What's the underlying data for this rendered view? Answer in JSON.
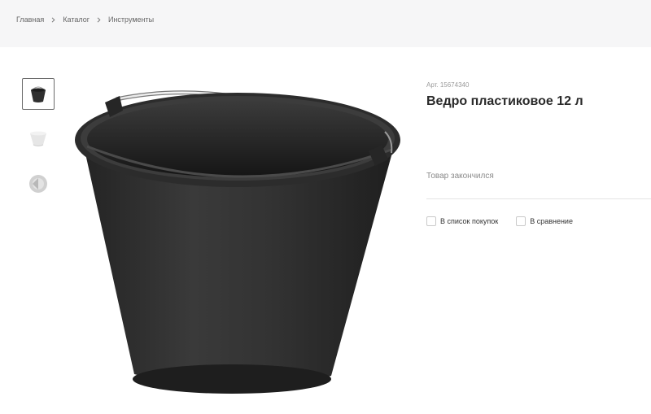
{
  "breadcrumb": {
    "items": [
      "Главная",
      "Каталог",
      "Инструменты"
    ],
    "separator_icon": "chevron-right-icon"
  },
  "gallery": {
    "thumbnails": [
      "bucket-black-icon",
      "bucket-white-icon",
      "round-product-icon"
    ],
    "active_index": 0,
    "main_image": "black-plastic-bucket-image"
  },
  "product": {
    "sku": "Арт. 15674340",
    "title": "Ведро пластиковое 12 л",
    "stock_status": "Товар закончился"
  },
  "actions": {
    "shopping_list_label": "В список покупок",
    "compare_label": "В сравнение",
    "shopping_list_checked": false,
    "compare_checked": false
  },
  "colors": {
    "topbar_bg": "#f6f6f7",
    "bucket": "#2f2f2f",
    "text_primary": "#2a2a2a",
    "text_muted": "#8a8a8a"
  }
}
